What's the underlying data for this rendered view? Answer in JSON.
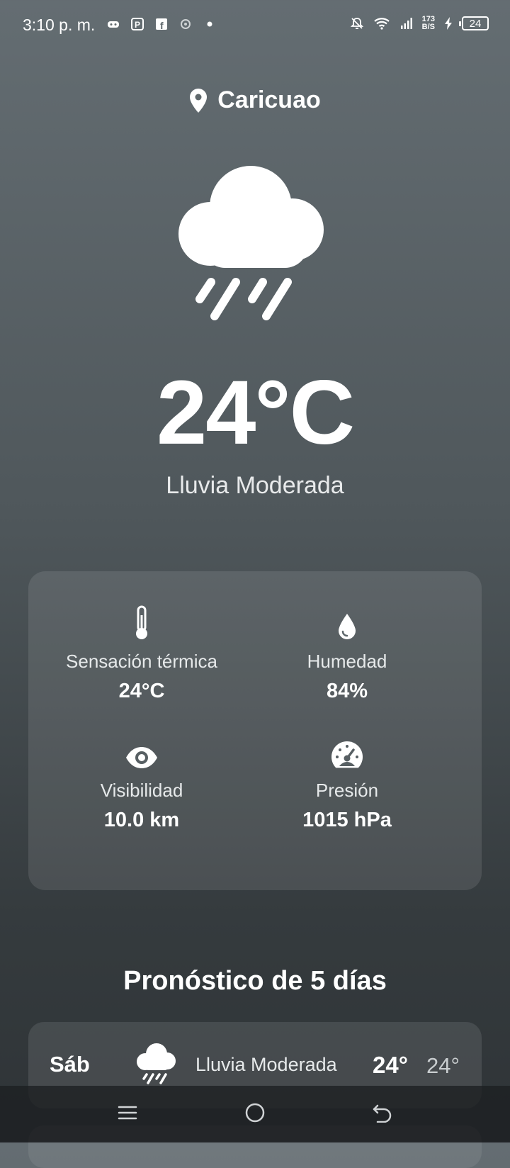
{
  "status_bar": {
    "time": "3:10 p. m.",
    "net_speed_value": "173",
    "net_speed_unit": "B/S",
    "battery": "24",
    "icons_left": [
      "game-icon",
      "parking-icon",
      "facebook-icon",
      "app-icon",
      "dot-icon"
    ],
    "icons_right": [
      "mute-bell-icon",
      "wifi-icon",
      "signal-icon",
      "charging-icon",
      "battery-icon"
    ]
  },
  "location": {
    "name": "Caricuao",
    "icon": "location-pin-icon"
  },
  "current": {
    "temperature": "24°C",
    "condition": "Lluvia Moderada",
    "icon": "rain-cloud-icon"
  },
  "details": {
    "feels_like": {
      "label": "Sensación térmica",
      "value": "24°C",
      "icon": "thermometer-icon"
    },
    "humidity": {
      "label": "Humedad",
      "value": "84%",
      "icon": "droplet-icon"
    },
    "visibility": {
      "label": "Visibilidad",
      "value": "10.0 km",
      "icon": "eye-icon"
    },
    "pressure": {
      "label": "Presión",
      "value": "1015 hPa",
      "icon": "gauge-icon"
    }
  },
  "forecast": {
    "title": "Pronóstico de 5 días",
    "days": [
      {
        "day": "Sáb",
        "condition": "Lluvia Moderada",
        "max": "24°",
        "min": "24°",
        "icon": "rain-cloud-icon"
      }
    ]
  },
  "nav": {
    "icons": [
      "menu-icon",
      "home-icon",
      "back-icon"
    ]
  },
  "colors": {
    "background_top": "#646d72",
    "background_bottom": "#2f3437",
    "card": "rgba(255,255,255,0.10)"
  }
}
